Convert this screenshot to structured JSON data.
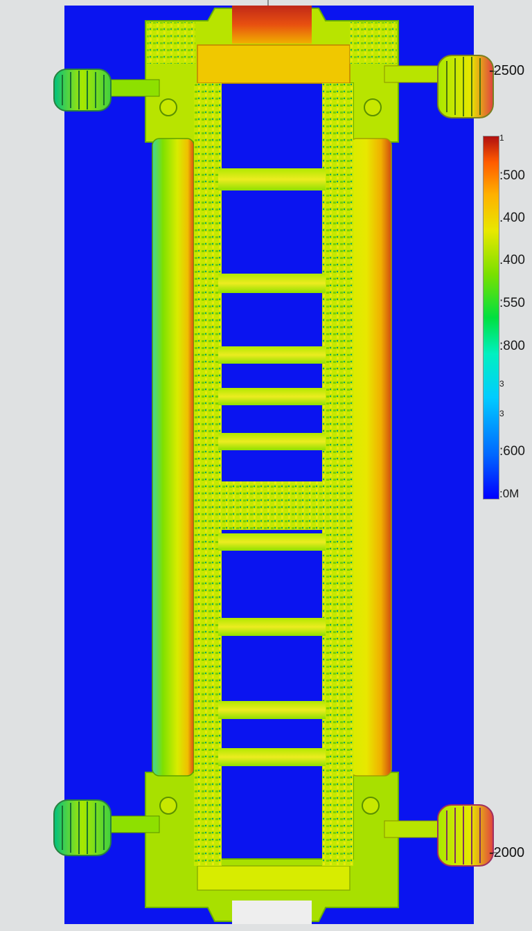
{
  "dimension_labels": {
    "top_right": "-2500",
    "bottom_right": "-2000"
  },
  "colorbar": {
    "colors": [
      "#0000ff",
      "#0066ff",
      "#00ccff",
      "#00f0c0",
      "#00e040",
      "#7ae000",
      "#e8e800",
      "#ffb000",
      "#ff5a00",
      "#b01010"
    ],
    "labels": [
      "1",
      ":500",
      ".400",
      ".400",
      ":550",
      ":800",
      "3",
      "3",
      ":600",
      ":0M"
    ]
  },
  "palette": {
    "background_field": "#0a14f0",
    "page": "#dfe1e2",
    "frame_green": "#8ee000",
    "frame_yellow": "#e8e800",
    "hot_red": "#c82a14"
  }
}
